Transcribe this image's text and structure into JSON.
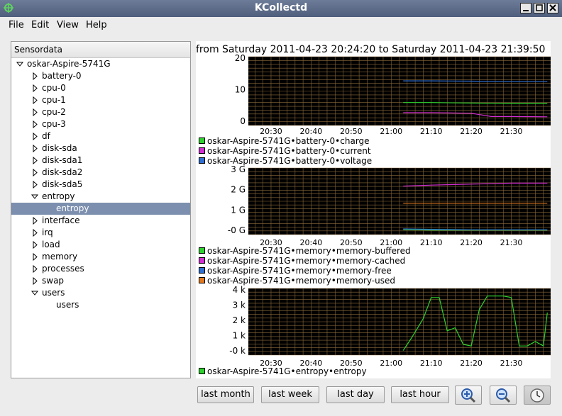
{
  "window": {
    "title": "KCollectd"
  },
  "menu": [
    {
      "label": "File"
    },
    {
      "label": "Edit"
    },
    {
      "label": "View"
    },
    {
      "label": "Help"
    }
  ],
  "tree": {
    "header": "Sensordata",
    "host": "oskar-Aspire-5741G",
    "items": [
      {
        "label": "battery-0",
        "expanded": false
      },
      {
        "label": "cpu-0",
        "expanded": false
      },
      {
        "label": "cpu-1",
        "expanded": false
      },
      {
        "label": "cpu-2",
        "expanded": false
      },
      {
        "label": "cpu-3",
        "expanded": false
      },
      {
        "label": "df",
        "expanded": false
      },
      {
        "label": "disk-sda",
        "expanded": false
      },
      {
        "label": "disk-sda1",
        "expanded": false
      },
      {
        "label": "disk-sda2",
        "expanded": false
      },
      {
        "label": "disk-sda5",
        "expanded": false
      },
      {
        "label": "entropy",
        "expanded": true,
        "child": "entropy",
        "child_selected": true
      },
      {
        "label": "interface",
        "expanded": false
      },
      {
        "label": "irq",
        "expanded": false
      },
      {
        "label": "load",
        "expanded": false
      },
      {
        "label": "memory",
        "expanded": false
      },
      {
        "label": "processes",
        "expanded": false
      },
      {
        "label": "swap",
        "expanded": false
      },
      {
        "label": "users",
        "expanded": true,
        "child": "users",
        "child_selected": false
      }
    ]
  },
  "graph": {
    "title": "from Saturday 2011-04-23 20:24:20 to Saturday 2011-04-23 21:39:50",
    "time_ticks": [
      "20:30",
      "20:40",
      "20:50",
      "21:00",
      "21:10",
      "21:20",
      "21:30"
    ],
    "colors": {
      "background": "#000000",
      "grid": "#8b6a3a",
      "green": "#2ed32e",
      "magenta": "#d22ed2",
      "blue": "#2e6fd2",
      "orange": "#e07a1f"
    }
  },
  "chart_data": [
    {
      "type": "line",
      "title": "",
      "ylim": [
        -5,
        22
      ],
      "yticks": [
        "20",
        "10",
        "0"
      ],
      "x": [
        "21:03",
        "21:10",
        "21:20",
        "21:25",
        "21:30",
        "21:39"
      ],
      "series": [
        {
          "name": "oskar-Aspire-5741G•battery-0•charge",
          "color": "#2ed32e",
          "values": [
            4,
            4,
            3.8,
            3.7,
            3.6,
            3.6
          ]
        },
        {
          "name": "oskar-Aspire-5741G•battery-0•current",
          "color": "#d22ed2",
          "values": [
            0,
            0,
            -0.2,
            -1.5,
            -1.5,
            -1.6
          ]
        },
        {
          "name": "oskar-Aspire-5741G•battery-0•voltage",
          "color": "#2e6fd2",
          "values": [
            12.5,
            12.5,
            12.4,
            12.3,
            12.2,
            12.2
          ]
        }
      ]
    },
    {
      "type": "line",
      "title": "",
      "ylim": [
        -0.1,
        3.2
      ],
      "yticks": [
        "3 G",
        "2 G",
        "1 G",
        "-0 G"
      ],
      "x": [
        "21:03",
        "21:10",
        "21:20",
        "21:25",
        "21:30",
        "21:39"
      ],
      "series": [
        {
          "name": "oskar-Aspire-5741G•memory•memory-buffered",
          "color": "#2ed32e",
          "values": [
            0.15,
            0.12,
            0.12,
            0.12,
            0.12,
            0.12
          ]
        },
        {
          "name": "oskar-Aspire-5741G•memory•memory-cached",
          "color": "#d22ed2",
          "values": [
            2.3,
            2.35,
            2.4,
            2.42,
            2.45,
            2.45
          ]
        },
        {
          "name": "oskar-Aspire-5741G•memory•memory-free",
          "color": "#2e6fd2",
          "values": [
            0.18,
            0.16,
            0.14,
            0.14,
            0.14,
            0.14
          ]
        },
        {
          "name": "oskar-Aspire-5741G•memory•memory-used",
          "color": "#e07a1f",
          "values": [
            1.45,
            1.45,
            1.45,
            1.45,
            1.45,
            1.45
          ]
        }
      ]
    },
    {
      "type": "line",
      "title": "",
      "ylim": [
        -0.2,
        4.2
      ],
      "yticks": [
        "4 k",
        "3 k",
        "2 k",
        "1 k",
        "-0 k"
      ],
      "x": [
        "21:03",
        "21:05",
        "21:08",
        "21:10",
        "21:12",
        "21:14",
        "21:16",
        "21:18",
        "21:20",
        "21:22",
        "21:24",
        "21:26",
        "21:28",
        "21:30",
        "21:32",
        "21:34",
        "21:36",
        "21:38",
        "21:39"
      ],
      "series": [
        {
          "name": "oskar-Aspire-5741G•entropy•entropy",
          "color": "#2ed32e",
          "values": [
            0.1,
            0.9,
            2.2,
            3.6,
            3.6,
            1.4,
            1.6,
            0.5,
            0.4,
            2.8,
            3.7,
            3.7,
            3.7,
            3.6,
            0.4,
            0.4,
            0.7,
            0.4,
            2.6
          ]
        }
      ]
    }
  ],
  "buttons": {
    "last_month": "last month",
    "last_week": "last week",
    "last_day": "last day",
    "last_hour": "last hour",
    "zoom_in": "zoom-in-icon",
    "zoom_out": "zoom-out-icon",
    "autoupdate": "clock-icon"
  }
}
